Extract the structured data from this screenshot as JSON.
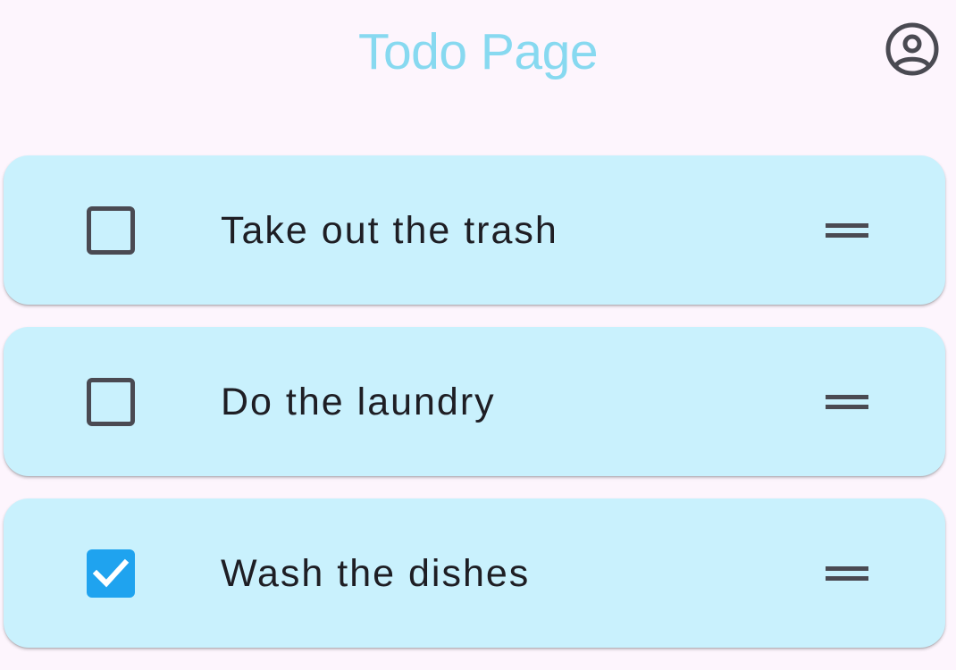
{
  "app_bar": {
    "title": "Todo Page",
    "account_icon": "account-circle-icon"
  },
  "colors": {
    "background": "#fdf5fd",
    "title": "#87d9f0",
    "card": "#c9f1fd",
    "checkbox_checked": "#1fa3ef",
    "icon": "#4a4a52"
  },
  "todos": [
    {
      "label": "Take out the trash",
      "checked": false,
      "handle_icon": "drag-handle-icon"
    },
    {
      "label": "Do the laundry",
      "checked": false,
      "handle_icon": "drag-handle-icon"
    },
    {
      "label": "Wash the dishes",
      "checked": true,
      "handle_icon": "drag-handle-icon"
    }
  ]
}
